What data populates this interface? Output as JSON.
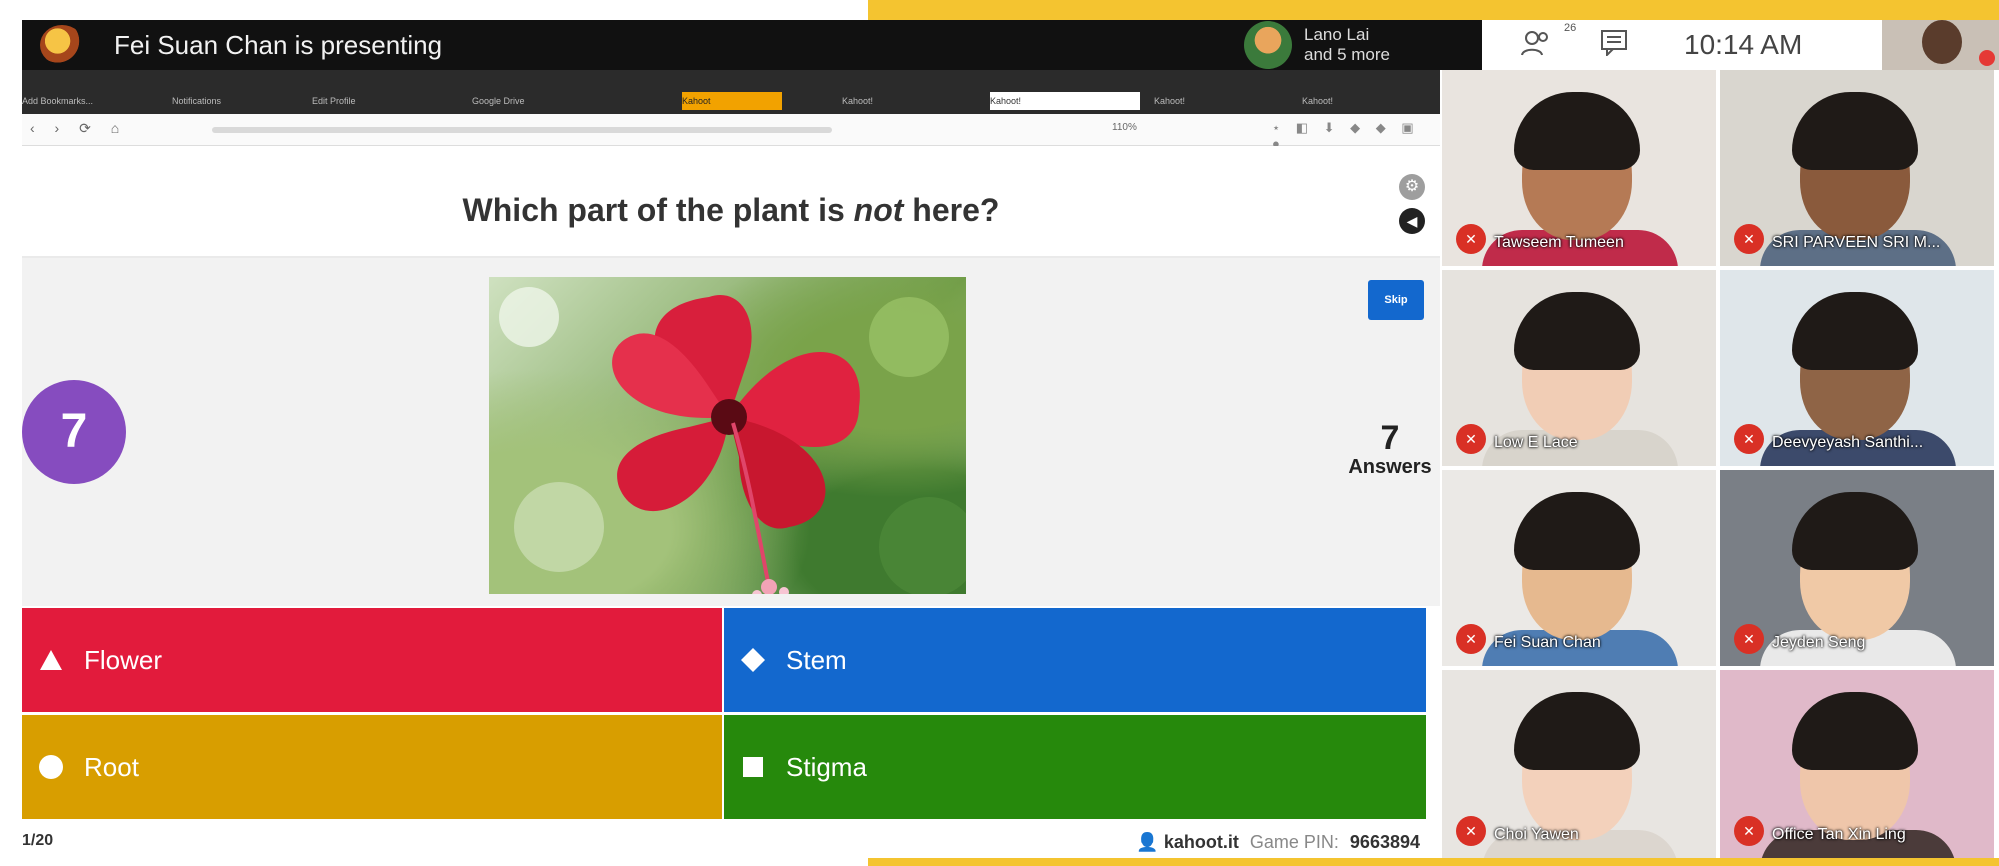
{
  "meet": {
    "presenter_title": "Fei Suan Chan is presenting",
    "others_line1": "Lano Lai",
    "others_line2": "and 5 more",
    "participants_count": "26",
    "time": "10:14 AM",
    "participants": [
      {
        "name": "Tawseem Tumeen",
        "bg": "#e9e4df",
        "skin": "#b57a55",
        "shirt": "#c02b4a"
      },
      {
        "name": "SRI PARVEEN SRI M...",
        "bg": "#d9d6cf",
        "skin": "#8a5a3c",
        "shirt": "#5d6f86"
      },
      {
        "name": "Low E Lace",
        "bg": "#e6e3de",
        "skin": "#f1cdb5",
        "shirt": "#d8d4cc"
      },
      {
        "name": "Deevyeyash Santhi...",
        "bg": "#dfe6ea",
        "skin": "#8f6446",
        "shirt": "#3c4a6b"
      },
      {
        "name": "Fei Suan Chan",
        "bg": "#ebe9e6",
        "skin": "#e6b98f",
        "shirt": "#4f7db3"
      },
      {
        "name": "Jeyden Seng",
        "bg": "#7a7f86",
        "skin": "#f0c9a6",
        "shirt": "#e9e9e9"
      },
      {
        "name": "Choi Yawen",
        "bg": "#e8e5e1",
        "skin": "#f3d1bb",
        "shirt": "#dcd6cf"
      },
      {
        "name": "Office Tan Xin Ling",
        "bg": "#e0b9c9",
        "skin": "#efc6aa",
        "shirt": "#4b3b3a"
      }
    ]
  },
  "browser": {
    "tabs": [
      "Add Bookmarks...",
      "Notifications",
      "Edit Profile",
      "Google Drive",
      "Kahoot",
      "Kahoot!",
      "Kahoot!",
      "Kahoot!",
      "Kahoot!"
    ],
    "zoom": "110%"
  },
  "kahoot": {
    "question_pre": "Which part of the plant is ",
    "question_em": "not",
    "question_post": " here?",
    "timer": "7",
    "skip_label": "Skip",
    "answers_count": "7",
    "answers_label": "Answers",
    "options": [
      {
        "label": "Flower",
        "shape": "triangle-icon",
        "color": "#e21b3c"
      },
      {
        "label": "Stem",
        "shape": "diamond-icon",
        "color": "#1368ce"
      },
      {
        "label": "Root",
        "shape": "circle-icon",
        "color": "#d89e00"
      },
      {
        "label": "Stigma",
        "shape": "square-icon",
        "color": "#26890c"
      }
    ],
    "footer_left": "1/20",
    "brand": "kahoot.it",
    "pin_label": "Game PIN:",
    "pin": "9663894"
  }
}
